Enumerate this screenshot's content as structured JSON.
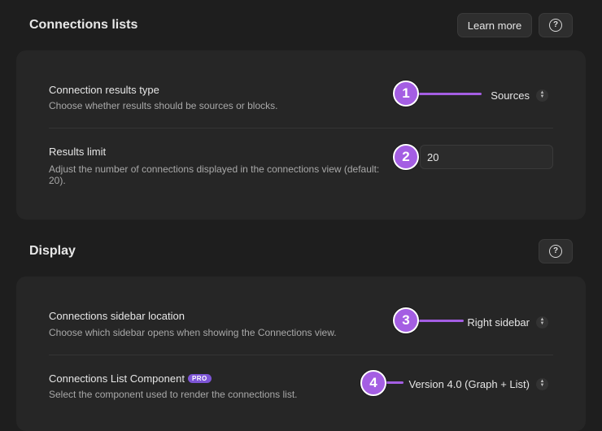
{
  "connections_lists": {
    "title": "Connections lists",
    "learn_more_label": "Learn more",
    "help_label": "?",
    "results_type": {
      "title": "Connection results type",
      "description": "Choose whether results should be sources or blocks.",
      "value": "Sources"
    },
    "results_limit": {
      "title": "Results limit",
      "description_line1": "Adjust the number of connections displayed in the connections view (default:",
      "description_line2": "20).",
      "value": "20"
    }
  },
  "display": {
    "title": "Display",
    "help_label": "?",
    "sidebar_location": {
      "title": "Connections sidebar location",
      "description": "Choose which sidebar opens when showing the Connections view.",
      "value": "Right sidebar"
    },
    "list_component": {
      "title": "Connections List Component",
      "pro_badge": "PRO",
      "description": "Select the component used to render the connections list.",
      "value": "Version 4.0 (Graph + List)"
    }
  },
  "annotations": [
    "1",
    "2",
    "3",
    "4"
  ],
  "colors": {
    "accent": "#a45ee3",
    "pro": "#7d55d6",
    "background": "#1e1e1e",
    "card": "#262626"
  }
}
